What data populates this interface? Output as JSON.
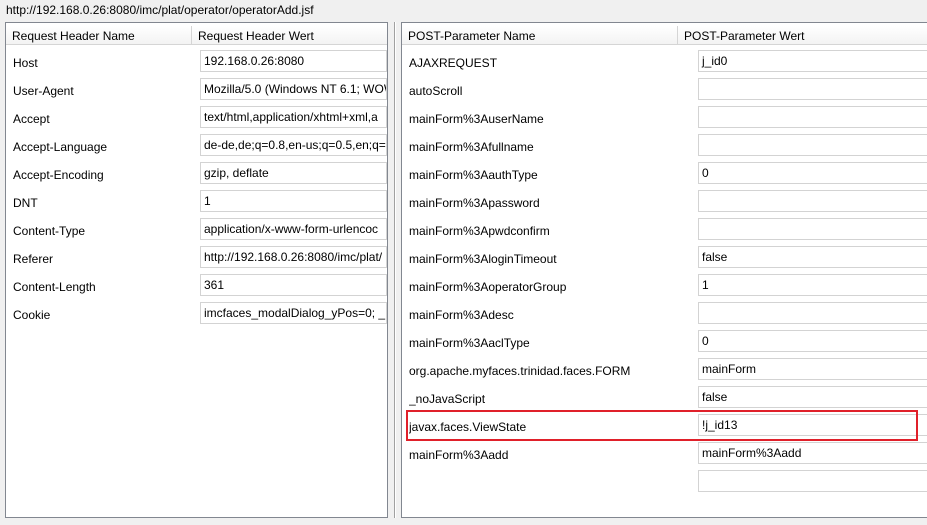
{
  "url": "http://192.168.0.26:8080/imc/plat/operator/operatorAdd.jsf",
  "request_headers": {
    "col_name": "Request Header Name",
    "col_value": "Request Header Wert",
    "rows": [
      {
        "name": "Host",
        "value": "192.168.0.26:8080"
      },
      {
        "name": "User-Agent",
        "value": "Mozilla/5.0 (Windows NT 6.1; WOW"
      },
      {
        "name": "Accept",
        "value": "text/html,application/xhtml+xml,a"
      },
      {
        "name": "Accept-Language",
        "value": "de-de,de;q=0.8,en-us;q=0.5,en;q="
      },
      {
        "name": "Accept-Encoding",
        "value": "gzip, deflate"
      },
      {
        "name": "DNT",
        "value": "1"
      },
      {
        "name": "Content-Type",
        "value": "application/x-www-form-urlencoc"
      },
      {
        "name": "Referer",
        "value": "http://192.168.0.26:8080/imc/plat/"
      },
      {
        "name": "Content-Length",
        "value": "361"
      },
      {
        "name": "Cookie",
        "value": "imcfaces_modalDialog_yPos=0; _I"
      }
    ]
  },
  "post_params": {
    "col_name": "POST-Parameter Name",
    "col_value": "POST-Parameter Wert",
    "rows": [
      {
        "name": "AJAXREQUEST",
        "value": "j_id0"
      },
      {
        "name": "autoScroll",
        "value": ""
      },
      {
        "name": "mainForm%3AuserName",
        "value": ""
      },
      {
        "name": "mainForm%3Afullname",
        "value": ""
      },
      {
        "name": "mainForm%3AauthType",
        "value": "0"
      },
      {
        "name": "mainForm%3Apassword",
        "value": ""
      },
      {
        "name": "mainForm%3Apwdconfirm",
        "value": ""
      },
      {
        "name": "mainForm%3AloginTimeout",
        "value": "false"
      },
      {
        "name": "mainForm%3AoperatorGroup",
        "value": "1"
      },
      {
        "name": "mainForm%3Adesc",
        "value": ""
      },
      {
        "name": "mainForm%3AaclType",
        "value": "0"
      },
      {
        "name": "org.apache.myfaces.trinidad.faces.FORM",
        "value": "mainForm"
      },
      {
        "name": "_noJavaScript",
        "value": "false"
      },
      {
        "name": "javax.faces.ViewState",
        "value": "!j_id13"
      },
      {
        "name": "mainForm%3Aadd",
        "value": "mainForm%3Aadd"
      },
      {
        "name": "",
        "value": ""
      }
    ]
  },
  "highlight_color": "#e0202a"
}
